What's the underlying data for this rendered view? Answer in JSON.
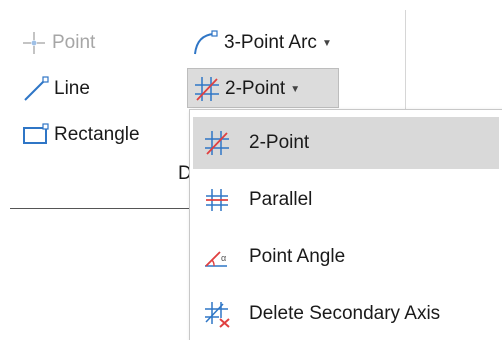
{
  "ribbon": {
    "point_label": "Point",
    "line_label": "Line",
    "rectangle_label": "Rectangle",
    "arc_label": "3-Point Arc",
    "axis_label": "2-Point",
    "group_label_clipped": "D"
  },
  "menu": {
    "items": [
      {
        "label": "2-Point",
        "icon": "two-point-axis-icon"
      },
      {
        "label": "Parallel",
        "icon": "parallel-axis-icon"
      },
      {
        "label": "Point Angle",
        "icon": "point-angle-icon"
      },
      {
        "label": "Delete Secondary Axis",
        "icon": "delete-secondary-axis-icon"
      }
    ]
  },
  "colors": {
    "blue": "#2f76c6",
    "red": "#e04040",
    "disabled": "#a6a6a6",
    "highlight": "#d9d9d9"
  }
}
